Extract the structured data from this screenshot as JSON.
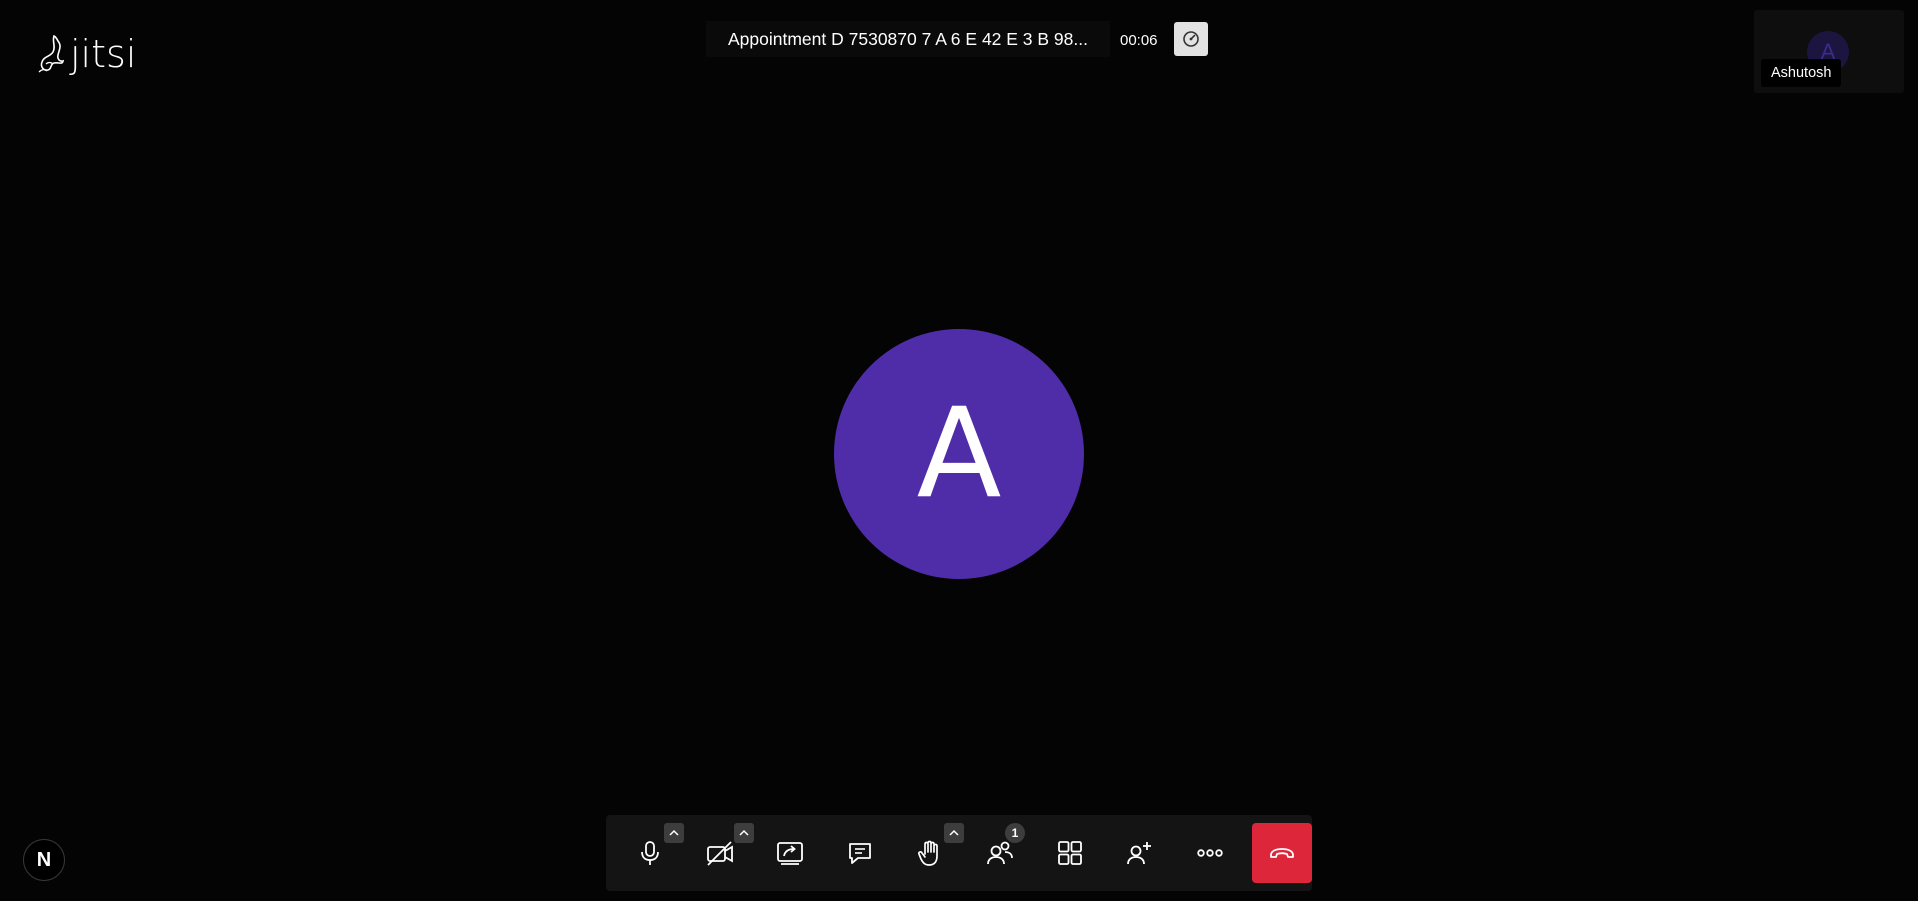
{
  "app": {
    "logo_text": "jitsi"
  },
  "header": {
    "subject": "Appointment D 7530870 7 A 6 E 42 E 3 B 98...",
    "timer": "00:06",
    "stats_icon": "gauge-icon"
  },
  "self_view": {
    "avatar_initial": "A",
    "name": "Ashutosh"
  },
  "main": {
    "avatar_initial": "A",
    "avatar_color": "#4f2da8"
  },
  "toolbar": {
    "participants_count": "1",
    "buttons": [
      {
        "id": "microphone",
        "icon": "microphone-icon"
      },
      {
        "id": "camera",
        "icon": "camera-off-icon"
      },
      {
        "id": "share-screen",
        "icon": "share-screen-icon"
      },
      {
        "id": "chat",
        "icon": "chat-icon"
      },
      {
        "id": "raise-hand",
        "icon": "hand-icon"
      },
      {
        "id": "participants",
        "icon": "participants-icon"
      },
      {
        "id": "tile-view",
        "icon": "tile-view-icon"
      },
      {
        "id": "invite",
        "icon": "add-person-icon"
      },
      {
        "id": "more",
        "icon": "more-icon"
      },
      {
        "id": "hangup",
        "icon": "hangup-icon"
      }
    ],
    "hangup_color": "#dd2639"
  },
  "corner_badge": {
    "letter": "N"
  }
}
